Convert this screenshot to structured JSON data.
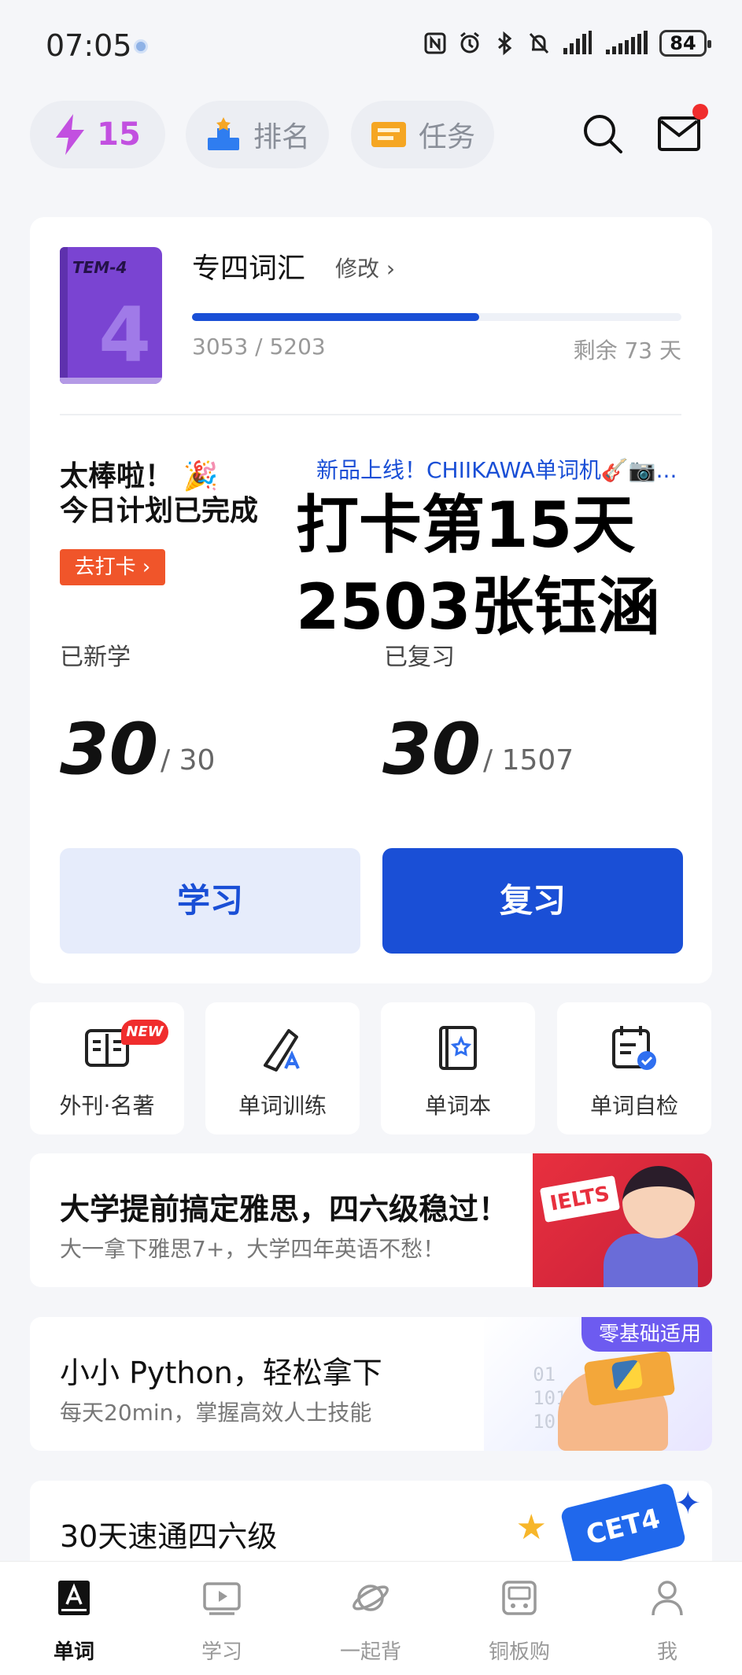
{
  "status_bar": {
    "time": "07:05",
    "battery": "84",
    "icons": [
      "nfc-icon",
      "alarm-icon",
      "bluetooth-icon",
      "mute-icon",
      "signal-icon",
      "signal-icon"
    ]
  },
  "header": {
    "energy_count": "15",
    "rank_label": "排名",
    "task_label": "任务",
    "has_unread_mail": true
  },
  "plan": {
    "book_tag": "TEM-4",
    "book_number": "4",
    "book_title": "专四词汇",
    "edit_label": "修改 ›",
    "progress_text": "3053 / 5203",
    "progress_value": 0.587,
    "remaining_text": "剩余 73 天",
    "great_text": "太棒啦！ 🎉",
    "plan_done_text": "今日计划已完成",
    "promo_text": "新品上线！CHIIKAWA单词机🎸📷...",
    "checkin_label": "去打卡 ›",
    "overlay_line1": "打卡第15天",
    "overlay_line2": "2503张钰涵",
    "learned_label": "已新学",
    "learned_value": "30",
    "learned_total": "/ 30",
    "reviewed_label": "已复习",
    "reviewed_value": "30",
    "reviewed_total": "/ 1507",
    "learn_button": "学习",
    "review_button": "复习"
  },
  "tiles": [
    {
      "label": "外刊·名著",
      "icon": "magazine-icon",
      "badge": "NEW"
    },
    {
      "label": "单词训练",
      "icon": "pen-icon"
    },
    {
      "label": "单词本",
      "icon": "wordbook-icon"
    },
    {
      "label": "单词自检",
      "icon": "calendar-check-icon"
    }
  ],
  "banners": [
    {
      "title": "大学提前搞定雅思，四六级稳过！",
      "subtitle": "大一拿下雅思7+，大学四年英语不愁！",
      "art_tag": "IELTS"
    },
    {
      "title": "小小 Python，轻松拿下",
      "subtitle": "每天20min，掌握高效人士技能",
      "ribbon": "零基础适用",
      "digits": "01\n1010\n10"
    },
    {
      "title": "30天速通四六级",
      "art_tag": "CET4"
    }
  ],
  "bottom_nav": [
    {
      "label": "单词",
      "icon": "word-icon",
      "active": true
    },
    {
      "label": "学习",
      "icon": "video-icon",
      "active": false
    },
    {
      "label": "一起背",
      "icon": "planet-icon",
      "active": false
    },
    {
      "label": "铜板购",
      "icon": "shop-icon",
      "active": false
    },
    {
      "label": "我",
      "icon": "profile-icon",
      "active": false
    }
  ],
  "colors": {
    "accent_blue": "#1a4fd6",
    "energy_purple": "#c250e0",
    "checkin_orange": "#f0552a",
    "badge_red": "#f02d2d"
  }
}
